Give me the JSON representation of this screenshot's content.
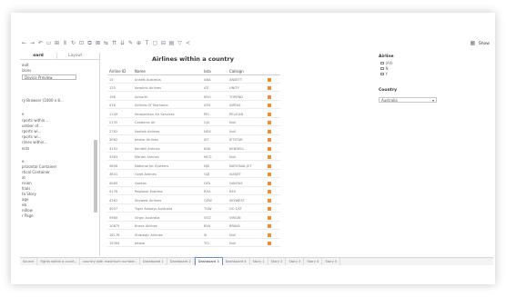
{
  "toolbar": {
    "icons": [
      "arrow-left-icon",
      "arrow-right-icon",
      "undo-icon",
      "save-icon",
      "new-datasource-icon",
      "pause-icon",
      "refresh-icon",
      "new-worksheet-icon",
      "duplicate-icon",
      "clear-icon",
      "swap-icon",
      "sort-ascending-icon",
      "sort-descending-icon",
      "highlight-icon",
      "group-icon",
      "label-icon",
      "fit-icon",
      "fix-axes-icon",
      "show-cards-icon",
      "presentation-icon",
      "share-icon"
    ],
    "show_me_label": "Show"
  },
  "left_panel": {
    "tabs": [
      "oard",
      "Layout"
    ],
    "items": [
      "ault",
      "izons",
      "Device Preview",
      "ry Browser (1000 x 8...",
      "e",
      "rports within...",
      "umber of...",
      "rports wi...",
      "rports wi...",
      "rlines within...",
      "ects",
      "e",
      "prizontal Container",
      "rtical Container",
      "xt",
      "nsion",
      "ltials",
      "ta Story",
      "age",
      "eb",
      "ndlow",
      "r Page"
    ]
  },
  "sheet": {
    "title": "Airlines within a country",
    "headers": [
      "Airline ID",
      "Name",
      "Iata",
      "Callsign"
    ],
    "rows": [
      [
        "15",
        "Ansett Australia",
        "ANA",
        "ANSETT"
      ],
      [
        "125",
        "Aerolink Airlines",
        "ATI",
        "UNITY"
      ],
      [
        "196",
        "Airnorth",
        "KRO",
        "TOPEND"
      ],
      [
        "476",
        "Airlines Of Tasmania",
        "ATN",
        "AIRTAS"
      ],
      [
        "1149",
        "Aeropelican Air Services",
        "PEL",
        "PELICAN"
      ],
      [
        "2135",
        "Canberra Air",
        "CJA",
        "Null"
      ],
      [
        "2782",
        "Norfolk Airlines",
        "NDS",
        "Null"
      ],
      [
        "3062",
        "Jetstar Airlines",
        "JST",
        "JETSTAR"
      ],
      [
        "3152",
        "Kendell Airlines",
        "KDA",
        "KENDELL"
      ],
      [
        "3363",
        "Maroni Airlines",
        "MCO",
        "Null"
      ],
      [
        "3608",
        "National Jet Systems",
        "NJS",
        "NATIONAL JET"
      ],
      [
        "3831",
        "Ozjet Airlines",
        "OZJ",
        "AUSJET"
      ],
      [
        "4089",
        "Qantas",
        "QFA",
        "QANTAS"
      ],
      [
        "4178",
        "Regional Express",
        "RXA",
        "REX"
      ],
      [
        "4762",
        "Skywest Airlines",
        "OZW",
        "SKYWEST"
      ],
      [
        "4937",
        "Tiger Airways Australia",
        "TGW",
        "GO CAT"
      ],
      [
        "5960",
        "Virgin Australia",
        "VOZ",
        "VIRGIN"
      ],
      [
        "10675",
        "Brava Airlines",
        "BVA",
        "BRAVA"
      ],
      [
        "16178",
        "Strategic Airlines",
        "SI",
        "Null"
      ],
      [
        "15394",
        "Jetstar",
        "TCL",
        "Null"
      ]
    ]
  },
  "filter": {
    "title": "Airline",
    "options": [
      "(All)",
      "N",
      "Y"
    ],
    "country_label": "Country",
    "country_value": "Australia"
  },
  "bottom_tabs": [
    "Source",
    "Fights within a count..",
    "country with maximum number..",
    "Dashboard 1",
    "Dashboard 2",
    "Dashboard 3",
    "Dashboard 4",
    "Story 1",
    "Story 2",
    "Story 3",
    "Story 4",
    "Story 5"
  ],
  "colors": {
    "mark": "#f28e2b",
    "accent": "#6a8fd0"
  }
}
